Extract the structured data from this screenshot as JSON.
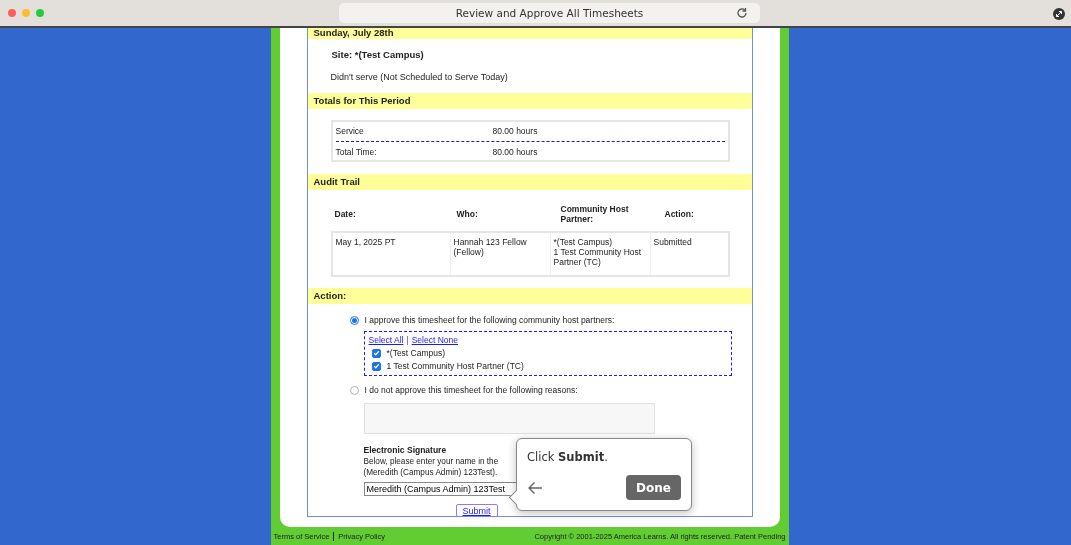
{
  "browser": {
    "title": "Review and Approve All Timesheets"
  },
  "day": {
    "heading": "Sunday, July 28th",
    "site": "Site: *(Test Campus)",
    "status": "Didn't serve (Not Scheduled to Serve Today)"
  },
  "totals": {
    "heading": "Totals for This Period",
    "rows": [
      {
        "label": "Service",
        "value": "80.00 hours"
      },
      {
        "label": "Total Time:",
        "value": "80.00 hours"
      }
    ]
  },
  "audit": {
    "heading": "Audit Trail",
    "columns": [
      "Date:",
      "Who:",
      "Community Host\nPartner:",
      "Action:"
    ],
    "rows": [
      {
        "cells": [
          "May 1, 2025 PT",
          "Hannah 123 Fellow\n(Fellow)",
          "*(Test Campus)\n1 Test Community Host\nPartner (TC)",
          "Submitted"
        ]
      }
    ]
  },
  "action": {
    "heading": "Action:",
    "options": [
      {
        "label": "I approve this timesheet for the following community host partners:",
        "selected": true
      },
      {
        "label": "I do not approve this timesheet for the following reasons:",
        "selected": false
      }
    ],
    "select_all": "Select All",
    "separator": "|",
    "select_none": "Select None",
    "partners": [
      {
        "label": "*(Test Campus)",
        "checked": true
      },
      {
        "label": "1 Test Community Host Partner (TC)",
        "checked": true
      }
    ]
  },
  "signature": {
    "heading": "Electronic Signature",
    "instructions": "Below, please enter your name in the\n(Meredith (Campus Admin) 123Test).",
    "value": "Meredith (Campus Admin) 123Test"
  },
  "submit": "Submit",
  "tooltip": {
    "text": "Click **Submit**.",
    "done": "Done"
  },
  "footer": {
    "links": [
      "Terms of Service",
      "Privacy Policy"
    ],
    "copyright": "Copyright © 2001-2025 America Learns. All rights reserved. Patent Pending"
  }
}
